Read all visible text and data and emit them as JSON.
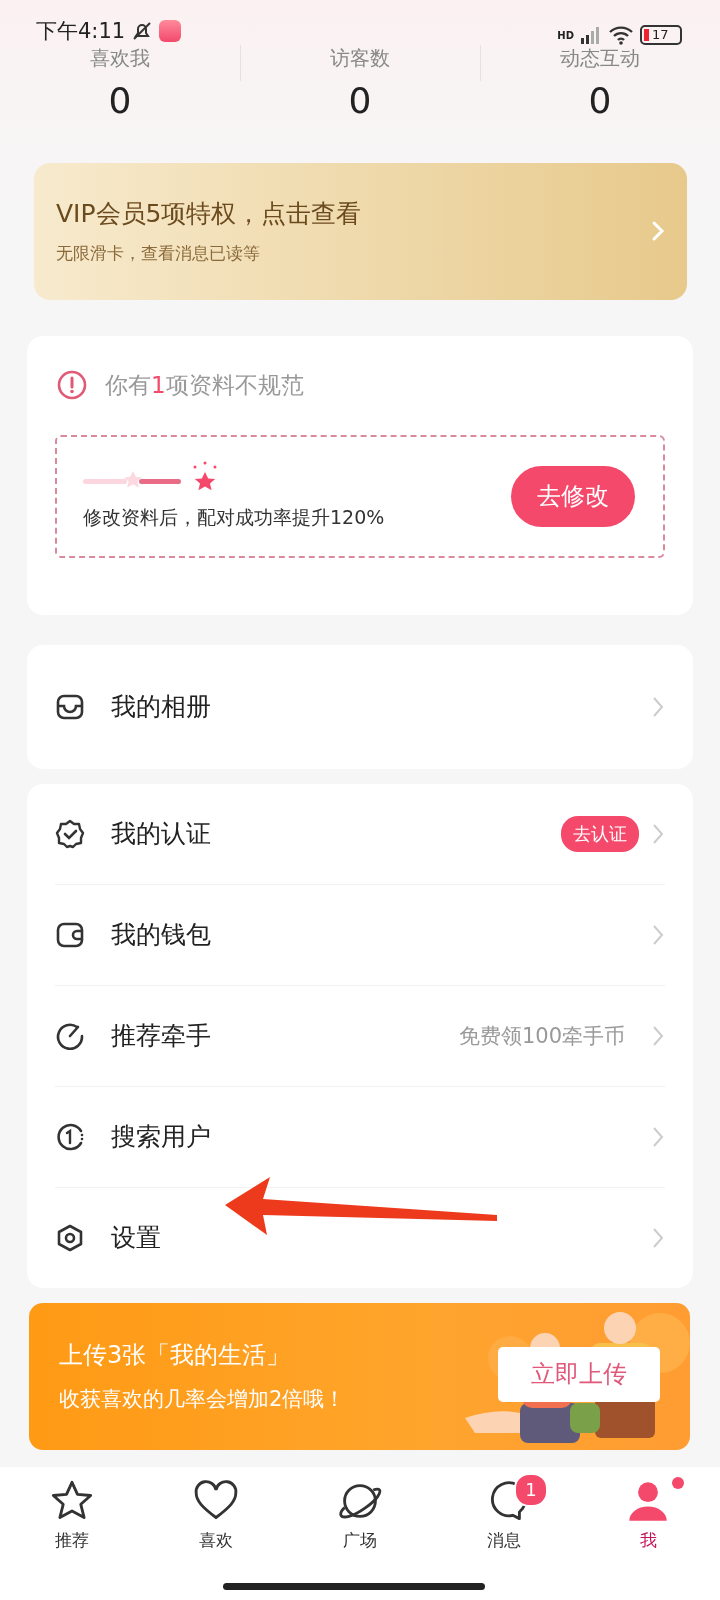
{
  "status_bar": {
    "time": "下午4:11",
    "network": "HD",
    "battery": "17"
  },
  "stats": [
    {
      "label": "喜欢我",
      "value": "0"
    },
    {
      "label": "访客数",
      "value": "0"
    },
    {
      "label": "动态互动",
      "value": "0"
    }
  ],
  "vip_banner": {
    "title": "VIP会员5项特权，点击查看",
    "subtitle": "无限滑卡，查看消息已读等"
  },
  "profile_notice": {
    "before": "你有",
    "highlight": "1",
    "after": "项资料不规范",
    "hint": "修改资料后，配对成功率提升120%",
    "button": "去修改"
  },
  "menu_groups": [
    {
      "items": [
        {
          "kind": "album",
          "label": "我的相册"
        }
      ]
    },
    {
      "items": [
        {
          "kind": "verify",
          "label": "我的认证",
          "badge": "去认证"
        },
        {
          "kind": "wallet",
          "label": "我的钱包"
        },
        {
          "kind": "recommend",
          "label": "推荐牵手",
          "hint": "免费领100牵手币"
        },
        {
          "kind": "search",
          "label": "搜索用户"
        },
        {
          "kind": "settings",
          "label": "设置"
        }
      ]
    }
  ],
  "upload_banner": {
    "title": "上传3张「我的生活」",
    "subtitle": "收获喜欢的几率会增加2倍哦！",
    "button": "立即上传"
  },
  "tab_bar": [
    {
      "kind": "star",
      "label": "推荐",
      "selected": false
    },
    {
      "kind": "heart",
      "label": "喜欢",
      "selected": false
    },
    {
      "kind": "planet",
      "label": "广场",
      "selected": false
    },
    {
      "kind": "chat",
      "label": "消息",
      "selected": false,
      "badge": "1"
    },
    {
      "kind": "person",
      "label": "我",
      "selected": true,
      "dot": true
    }
  ],
  "annotation": {
    "kind": "arrow"
  }
}
